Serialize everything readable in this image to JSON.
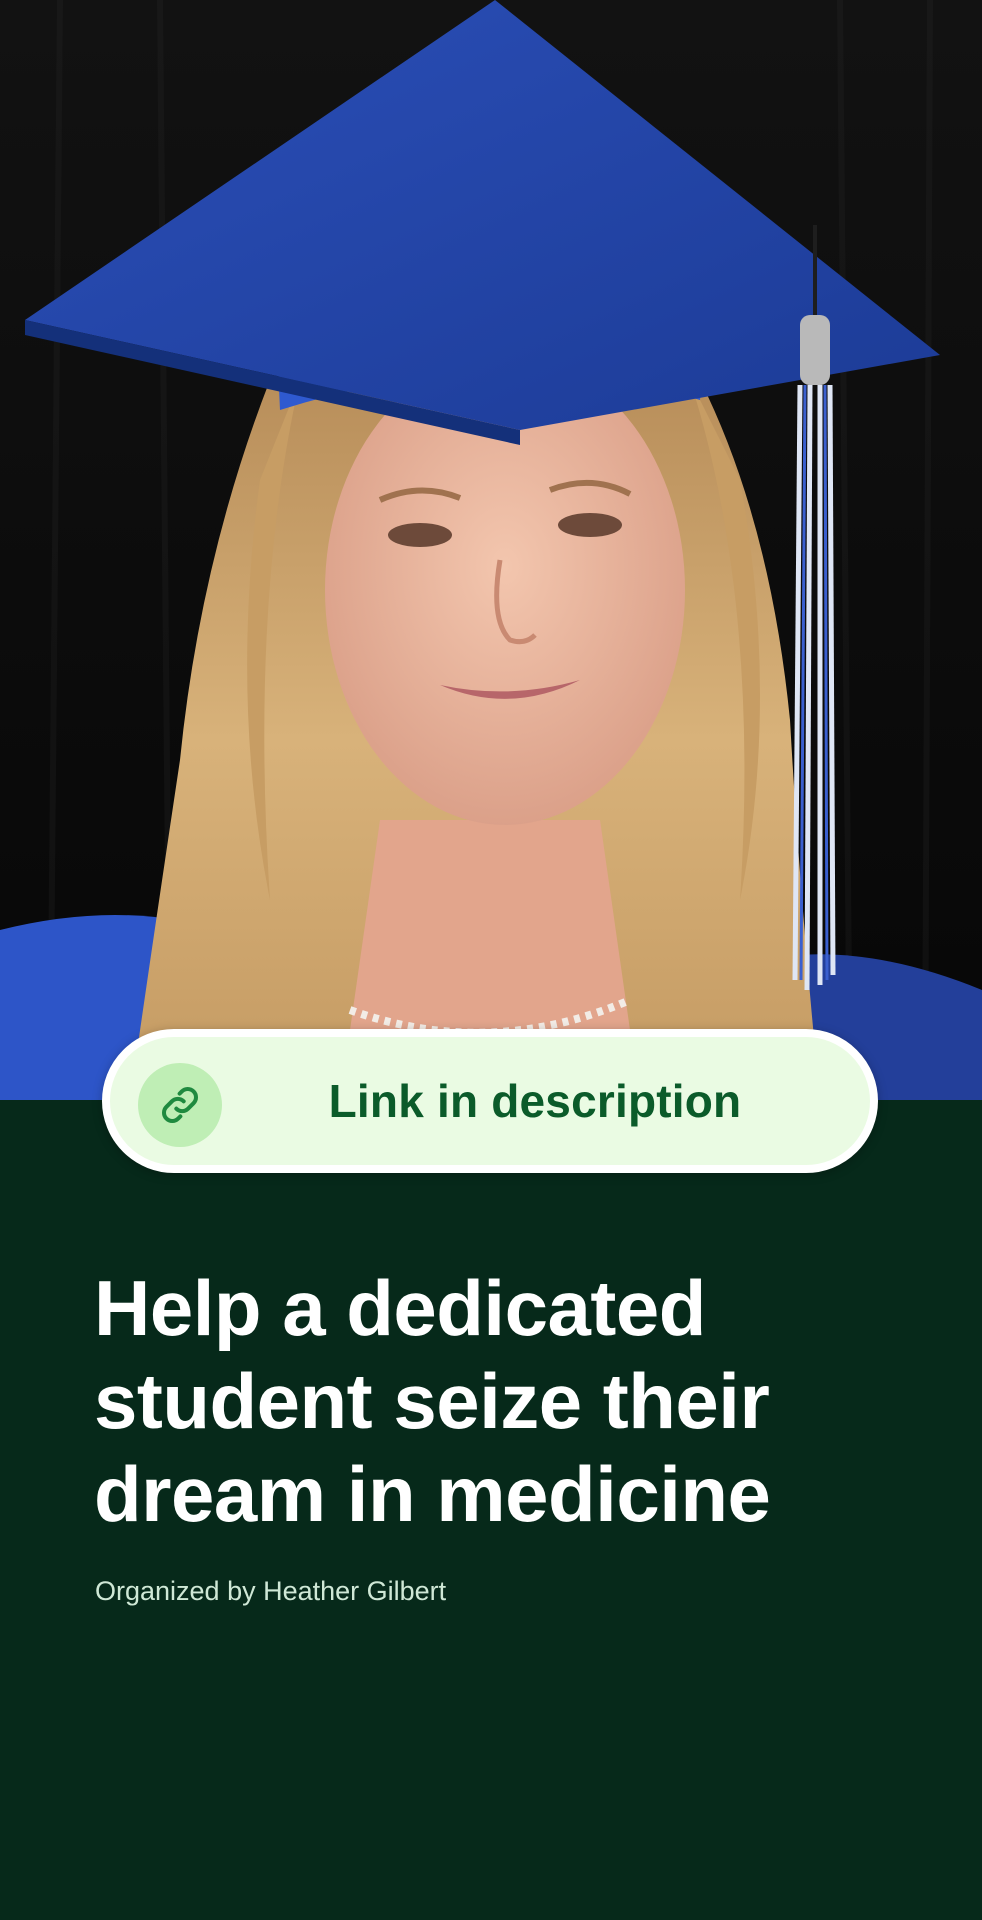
{
  "hero": {
    "image": "graduate-portrait",
    "colors": {
      "background": "#0b0b0b",
      "cap": "#2d55c8",
      "hair": "#c9a06a",
      "skin": "#e8b49c"
    }
  },
  "link_button": {
    "label": "Link in description",
    "icon": "link-icon",
    "colors": {
      "pill_bg": "#eafbe3",
      "icon_bg": "#bfeeb5",
      "text": "#0b5b2a"
    }
  },
  "campaign": {
    "title_lines": [
      "Help a dedicated",
      "student seize their",
      "dream in medicine"
    ],
    "organizer": "Organized by Heather Gilbert"
  },
  "theme": {
    "background": "#06291a",
    "title_color": "#ffffff"
  }
}
